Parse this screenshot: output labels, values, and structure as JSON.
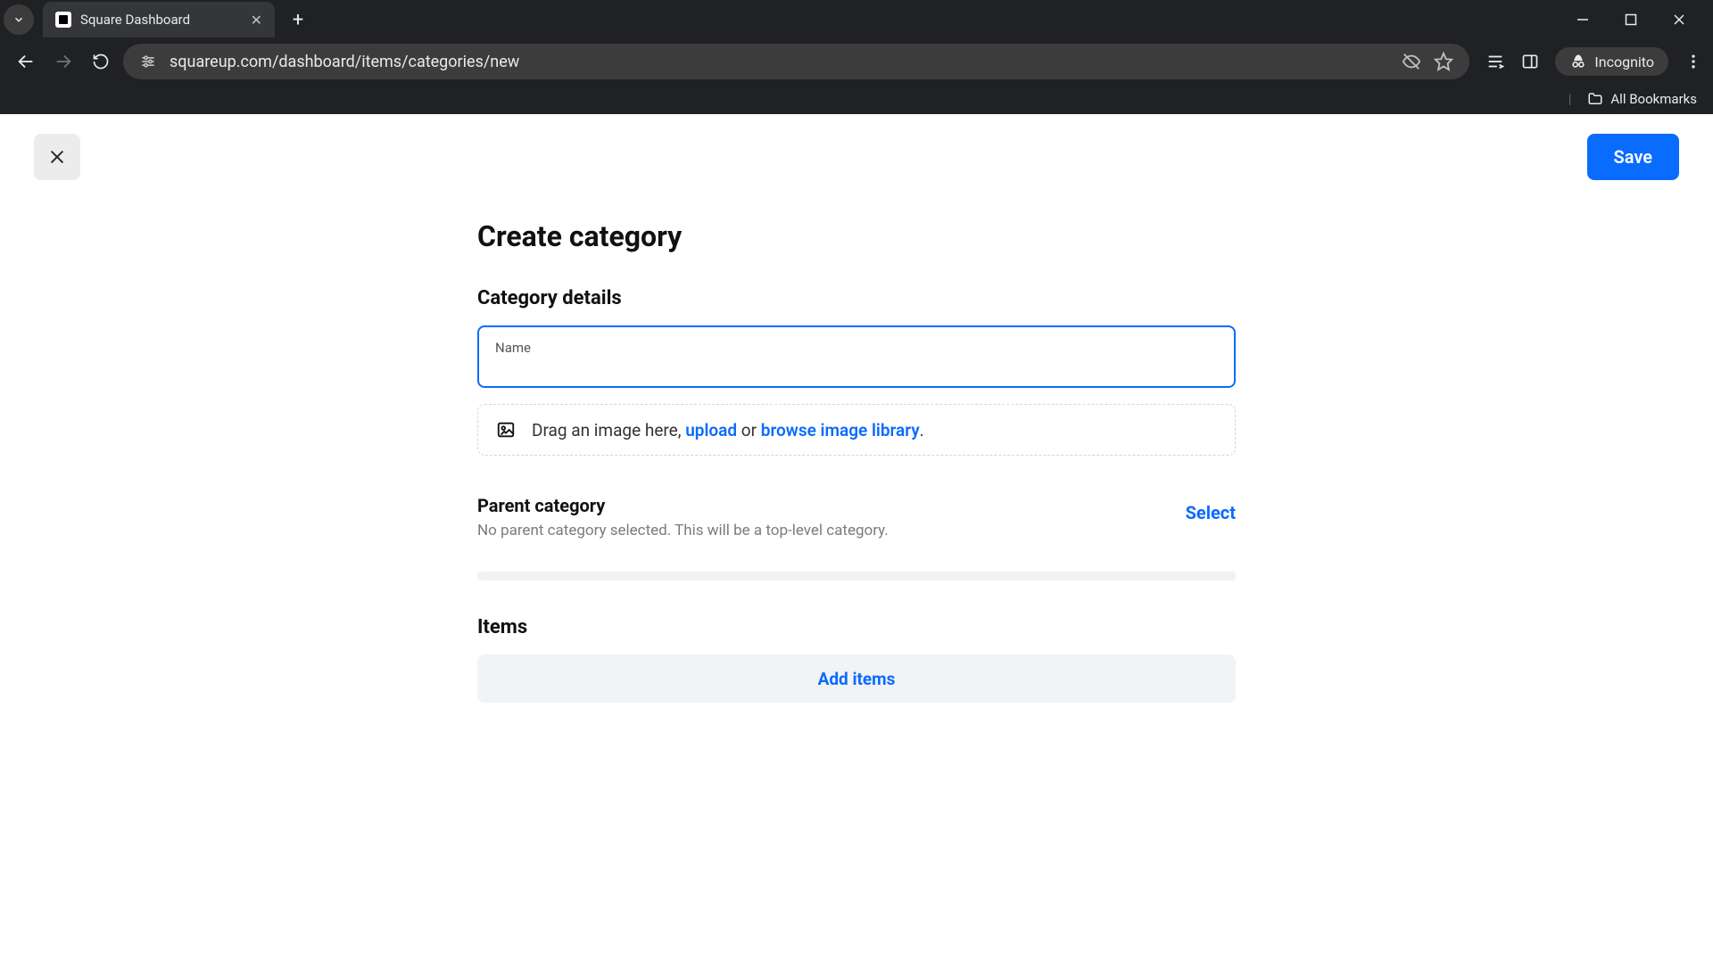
{
  "browser": {
    "tab_title": "Square Dashboard",
    "url": "squareup.com/dashboard/items/categories/new",
    "incognito_label": "Incognito",
    "all_bookmarks": "All Bookmarks"
  },
  "modal": {
    "save_label": "Save"
  },
  "page": {
    "title": "Create category",
    "details_heading": "Category details",
    "name_label": "Name",
    "name_value": "",
    "drop": {
      "prefix": "Drag an image here, ",
      "upload": "upload",
      "middle": " or ",
      "browse": "browse image library",
      "suffix": "."
    },
    "parent": {
      "title": "Parent category",
      "desc": "No parent category selected. This will be a top-level category.",
      "select_label": "Select"
    },
    "items_heading": "Items",
    "add_items_label": "Add items"
  }
}
